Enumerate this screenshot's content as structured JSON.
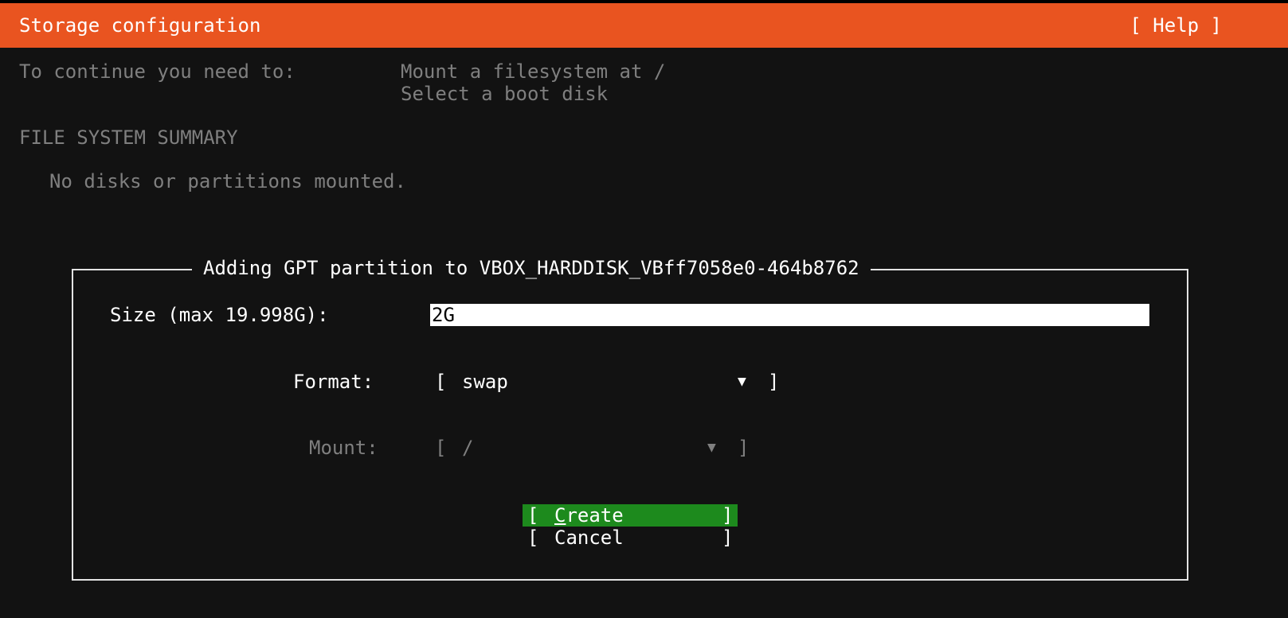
{
  "header": {
    "title": "Storage configuration",
    "help": "[ Help ]"
  },
  "requirements": {
    "intro": "To continue you need to:",
    "item1": "Mount a filesystem at /",
    "item2": "Select a boot disk"
  },
  "summary": {
    "heading": "FILE SYSTEM SUMMARY",
    "empty_text": "No disks or partitions mounted."
  },
  "dialog": {
    "title": "Adding GPT partition to VBOX_HARDDISK_VBff7058e0-464b8762",
    "size_label": "Size (max 19.998G):",
    "size_value": "2G",
    "format_label": "Format:",
    "format_value": "swap",
    "mount_label": "Mount:",
    "mount_value": "/",
    "dropdown_arrow": "▼",
    "create_first": "C",
    "create_rest": "reate",
    "cancel_label": "Cancel"
  }
}
